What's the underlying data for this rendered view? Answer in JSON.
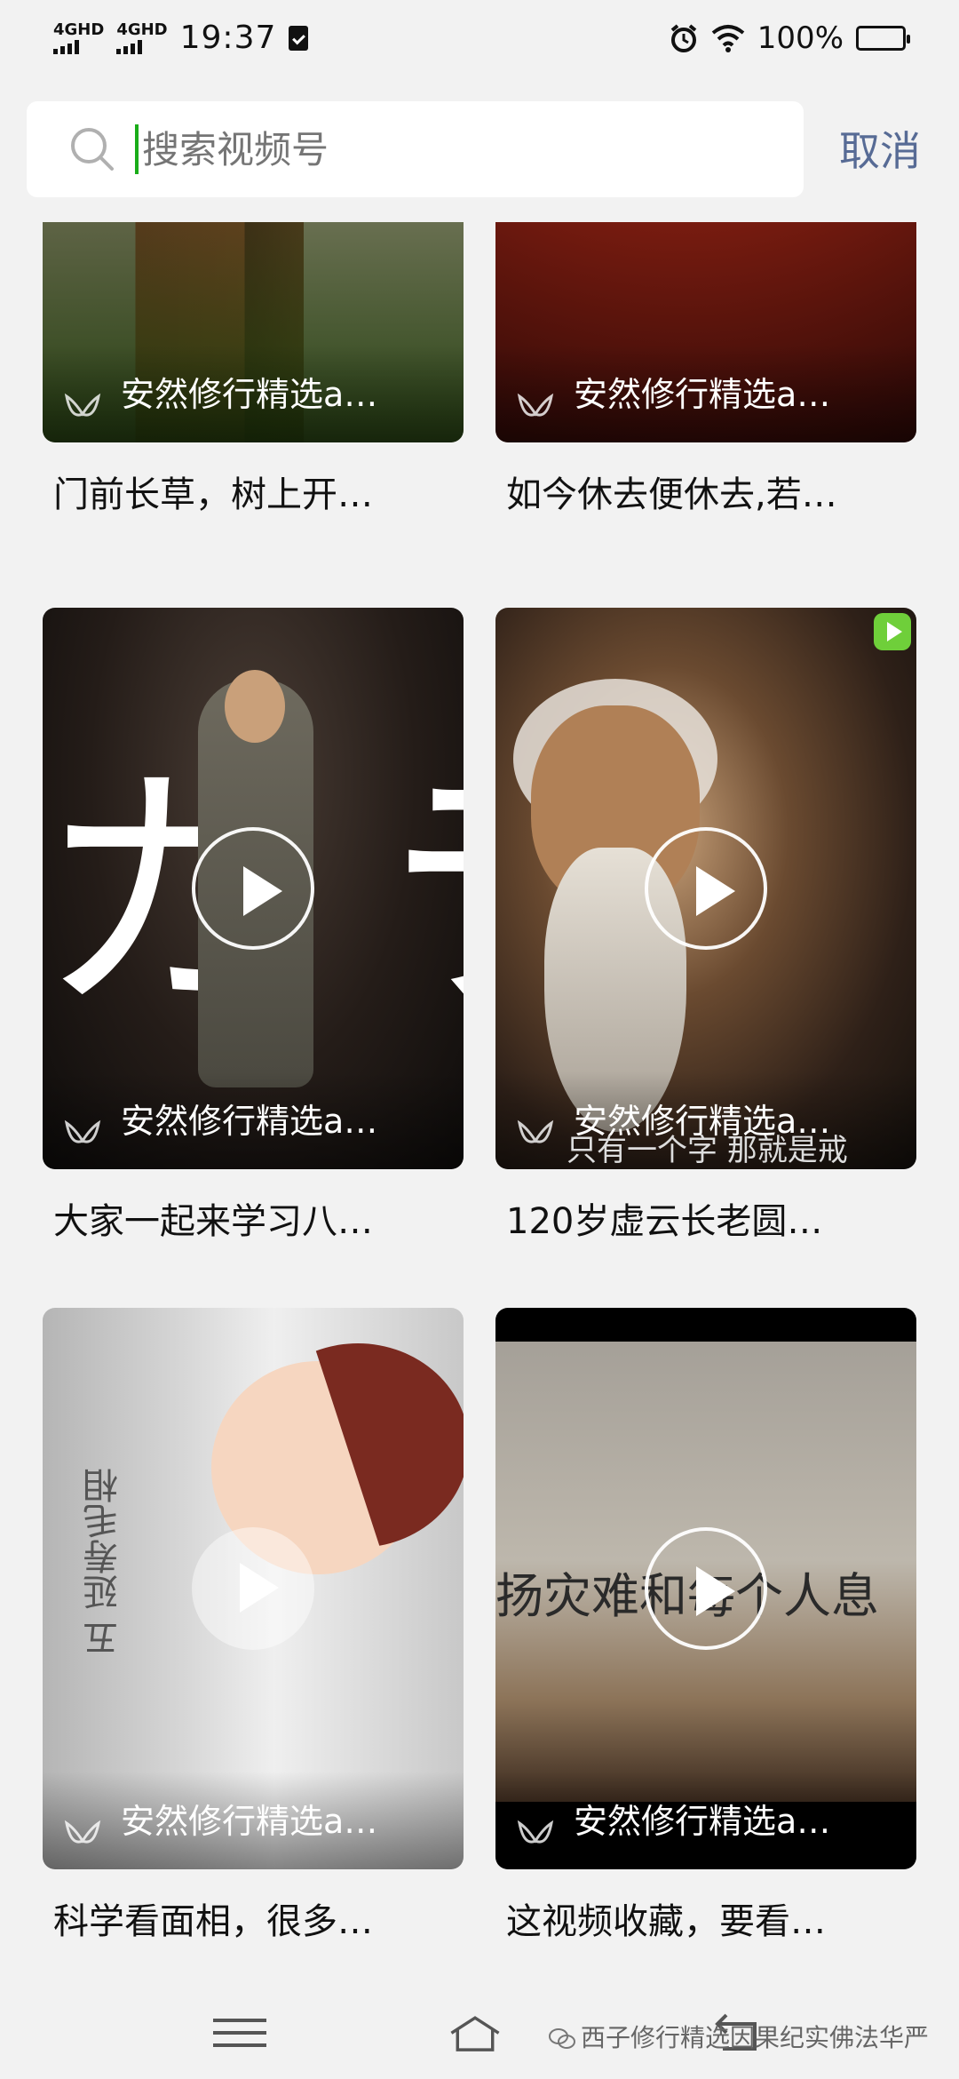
{
  "status_bar": {
    "network_1": "4GHD",
    "network_2": "4GHD",
    "time": "19:37",
    "battery": "100%"
  },
  "search": {
    "placeholder": "搜索视频号",
    "cancel_label": "取消"
  },
  "videos": [
    {
      "channel": "安然修行精选a…",
      "title": "门前长草，树上开…"
    },
    {
      "channel": "安然修行精选a…",
      "title": "如今休去便休去,若…"
    },
    {
      "channel": "安然修行精选a…",
      "title": "大家一起来学习八…"
    },
    {
      "channel": "安然修行精选a…",
      "title": "120岁虚云长老圆…"
    },
    {
      "channel": "安然修行精选a…",
      "title": "科学看面相，很多…"
    },
    {
      "channel": "安然修行精选a…",
      "title": "这视频收藏，要看…"
    }
  ],
  "thumb_text": {
    "big_glyphs": "カ",
    "big_glyph_right": "ラ",
    "sage_subtitle": "只有一个字 那就是戒",
    "cartoon_vertical": "五 延寿毛相",
    "banner_text": "扬灾难和每个人息"
  },
  "watermark": "西子修行精选因果纪实佛法华严",
  "icons": {
    "search": "search-icon",
    "play": "play-icon",
    "channel_logo": "channels-logo-icon",
    "menu": "menu-icon",
    "home": "home-icon",
    "back": "back-icon",
    "alarm": "alarm-icon",
    "wifi": "wifi-icon",
    "battery": "battery-icon"
  }
}
